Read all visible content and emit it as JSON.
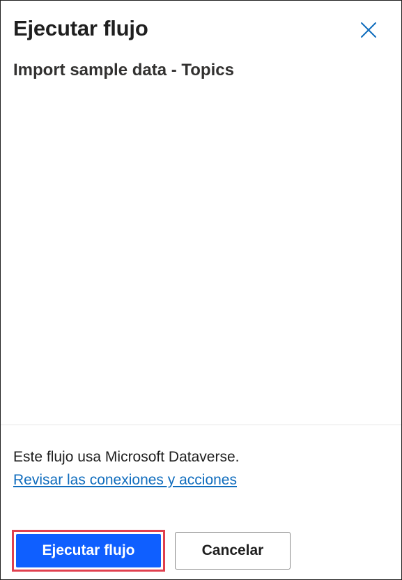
{
  "dialog": {
    "title": "Ejecutar flujo",
    "subtitle": "Import sample data - Topics",
    "close_icon": "close-icon"
  },
  "footer": {
    "info_text": "Este flujo usa Microsoft Dataverse.",
    "review_link": "Revisar las conexiones y acciones",
    "primary_label": "Ejecutar flujo",
    "secondary_label": "Cancelar"
  },
  "colors": {
    "primary": "#0f5fff",
    "link": "#0f6cbd",
    "focus_highlight": "#e0404f",
    "close_icon": "#0f6cbd"
  }
}
